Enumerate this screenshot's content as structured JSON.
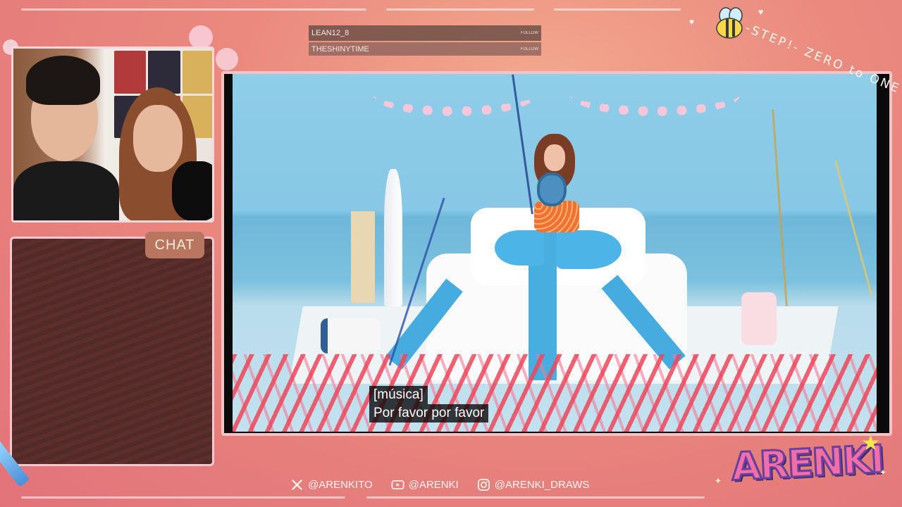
{
  "overlay": {
    "follow_events": [
      {
        "name": "LEAN12_8",
        "action": "FOLLOW"
      },
      {
        "name": "THESHINYTIME",
        "action": "FOLLOW"
      }
    ],
    "chat_label": "CHAT",
    "brand_tagline": "-STEP!- ZERO to ONE",
    "logo_text": "ARENKI",
    "socials": [
      {
        "platform": "x-icon",
        "handle": "@ARENKITO"
      },
      {
        "platform": "youtube-icon",
        "handle": "@ARENKI"
      },
      {
        "platform": "instagram-icon",
        "handle": "@ARENKI_DRAWS"
      }
    ]
  },
  "video": {
    "subtitle_line1": "[música]",
    "subtitle_line2": "Por favor por favor"
  },
  "colors": {
    "background": "#e8817c",
    "frame_border": "#f6c3c5",
    "chat_bg": "#5a2f2c",
    "logo_pink": "#f06fa8"
  }
}
